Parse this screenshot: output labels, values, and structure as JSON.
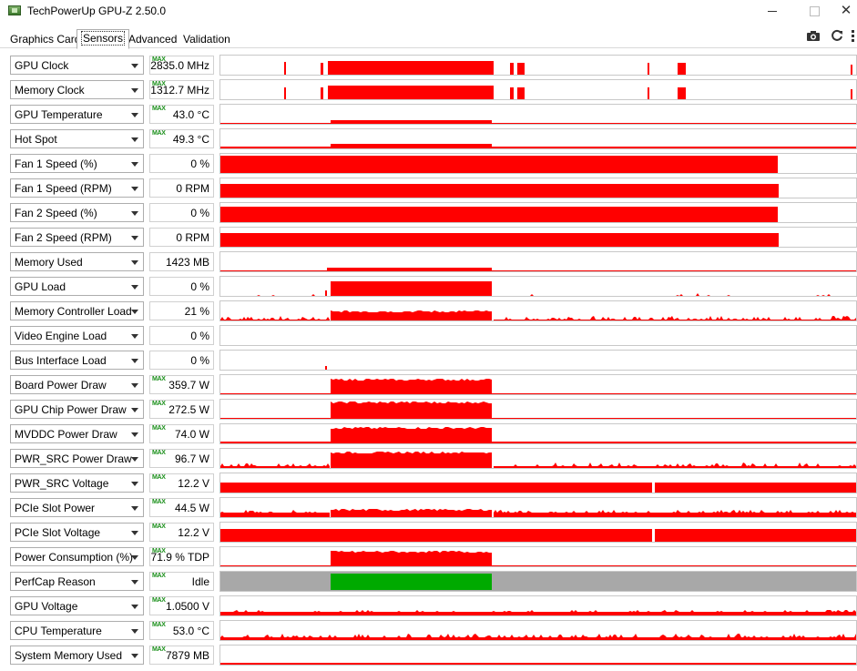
{
  "window": {
    "title": "TechPowerUp GPU-Z 2.50.0",
    "icon": "gpu-z-icon"
  },
  "tabs": [
    {
      "label": "Graphics Card"
    },
    {
      "label": "Sensors",
      "active": true
    },
    {
      "label": "Advanced"
    },
    {
      "label": "Validation"
    }
  ],
  "toolbar": {
    "icons": [
      "camera-icon",
      "refresh-icon",
      "menu-icon"
    ]
  },
  "colors": {
    "graph_red": "#ff0000",
    "perfcap_idle": "#a8a8a8",
    "perfcap_vrel": "#00aa00",
    "max_badge": "#1a8f1a"
  },
  "max_badge_text": "MAX",
  "sensors": [
    {
      "name": "GPU Clock",
      "value": "2835.0 MHz",
      "max": true
    },
    {
      "name": "Memory Clock",
      "value": "1312.7 MHz",
      "max": true
    },
    {
      "name": "GPU Temperature",
      "value": "43.0 °C",
      "max": true
    },
    {
      "name": "Hot Spot",
      "value": "49.3 °C",
      "max": true
    },
    {
      "name": "Fan 1 Speed (%)",
      "value": "0 %",
      "max": false
    },
    {
      "name": "Fan 1 Speed (RPM)",
      "value": "0 RPM",
      "max": false
    },
    {
      "name": "Fan 2 Speed (%)",
      "value": "0 %",
      "max": false
    },
    {
      "name": "Fan 2 Speed (RPM)",
      "value": "0 RPM",
      "max": false
    },
    {
      "name": "Memory Used",
      "value": "1423 MB",
      "max": false
    },
    {
      "name": "GPU Load",
      "value": "0 %",
      "max": false
    },
    {
      "name": "Memory Controller Load",
      "value": "21 %",
      "max": false
    },
    {
      "name": "Video Engine Load",
      "value": "0 %",
      "max": false
    },
    {
      "name": "Bus Interface Load",
      "value": "0 %",
      "max": false
    },
    {
      "name": "Board Power Draw",
      "value": "359.7 W",
      "max": true
    },
    {
      "name": "GPU Chip Power Draw",
      "value": "272.5 W",
      "max": true
    },
    {
      "name": "MVDDC Power Draw",
      "value": "74.0 W",
      "max": true
    },
    {
      "name": "PWR_SRC Power Draw",
      "value": "96.7 W",
      "max": true
    },
    {
      "name": "PWR_SRC Voltage",
      "value": "12.2 V",
      "max": true
    },
    {
      "name": "PCIe Slot Power",
      "value": "44.5 W",
      "max": true
    },
    {
      "name": "PCIe Slot Voltage",
      "value": "12.2 V",
      "max": true
    },
    {
      "name": "Power Consumption (%)",
      "value": "71.9 % TDP",
      "max": true
    },
    {
      "name": "PerfCap Reason",
      "value": "Idle",
      "max": true
    },
    {
      "name": "GPU Voltage",
      "value": "1.0500 V",
      "max": true
    },
    {
      "name": "CPU Temperature",
      "value": "53.0 °C",
      "max": true
    },
    {
      "name": "System Memory Used",
      "value": "7879 MB",
      "max": true
    }
  ]
}
